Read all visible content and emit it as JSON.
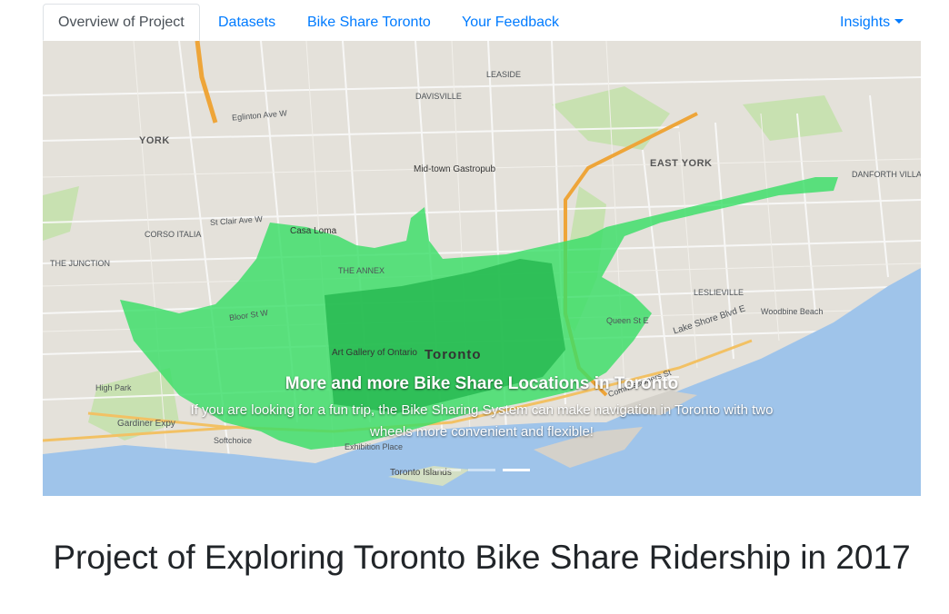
{
  "nav": {
    "tabs": [
      {
        "label": "Overview of Project",
        "active": true
      },
      {
        "label": "Datasets",
        "active": false
      },
      {
        "label": "Bike Share Toronto",
        "active": false
      },
      {
        "label": "Your Feedback",
        "active": false
      }
    ],
    "dropdown_label": "Insights",
    "dropdown_icon": "caret-down-icon"
  },
  "carousel": {
    "caption_title": "More and more Bike Share Locations in Toronto",
    "caption_text": "If you are looking for a fun trip, the Bike Sharing System can make navigation in Toronto with two wheels more convenient and flexible!",
    "slide_count": 3,
    "active_slide": 3
  },
  "map_labels": {
    "york": "YORK",
    "east_york": "EAST YORK",
    "toronto": "Toronto",
    "midtown_gastropub": "Mid-town Gastropub",
    "casa_loma": "Casa Loma",
    "art_gallery": "Art Gallery of Ontario",
    "lake_shore_blvd": "Lake Shore Blvd E",
    "gardiner_expy": "Gardiner Expy",
    "exhibition_place": "Exhibition Place",
    "toronto_islands": "Toronto Islands",
    "softchoice": "Softchoice",
    "high_park": "High Park",
    "woodbine_beach": "Woodbine Beach",
    "leslieville": "LESLIEVILLE",
    "the_annex": "THE ANNEX",
    "danforth_village": "DANFORTH VILLAGE",
    "eglinton_ave": "Eglinton Ave W",
    "st_clair_ave": "St Clair Ave W",
    "bloor_st": "Bloor St W",
    "queen_st": "Queen St E",
    "corso_italia": "CORSO ITALIA",
    "leaside": "LEASIDE",
    "davisville": "DAVISVILLE",
    "the_junction": "THE JUNCTION",
    "commissioners_st": "Commissioners St"
  },
  "page": {
    "title": "Project of Exploring Toronto Bike Share Ridership in 2017"
  },
  "colors": {
    "link": "#007bff",
    "map_land": "#e9e6df",
    "map_water": "#a3c8ef",
    "map_park": "#cde6b5",
    "coverage": "#3ce36a",
    "coverage_dark": "#22b84d"
  }
}
